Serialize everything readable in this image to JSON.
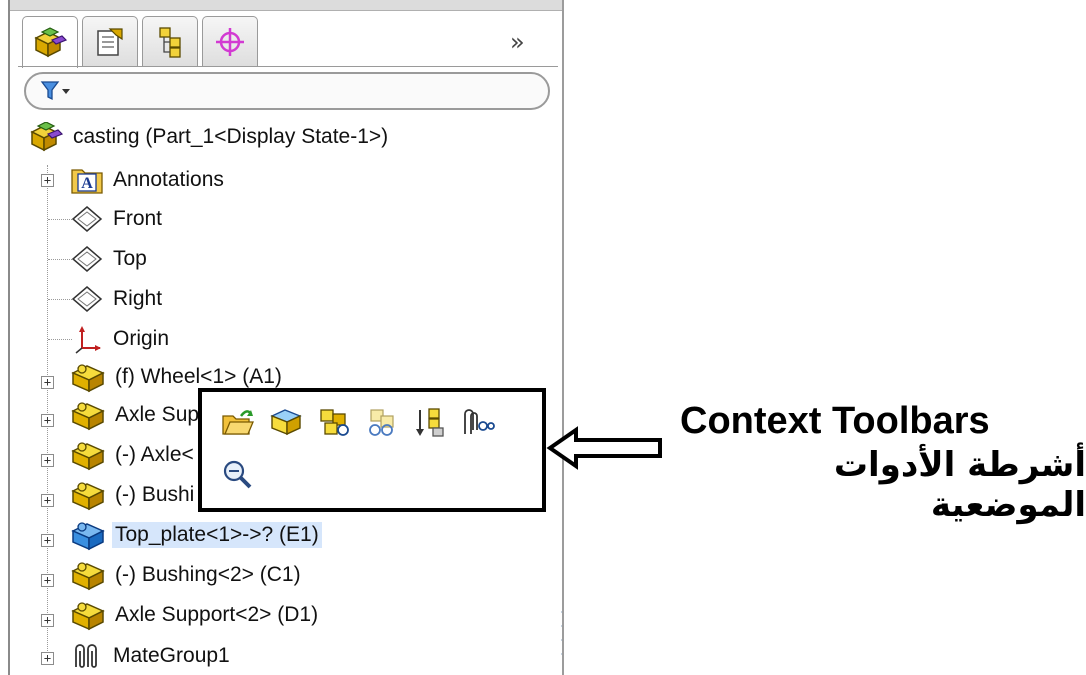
{
  "tabs": [
    {
      "name": "featuremanager-tab",
      "icon": "part-cubes-icon"
    },
    {
      "name": "propertymanager-tab",
      "icon": "property-sheet-icon"
    },
    {
      "name": "configurationmanager-tab",
      "icon": "configuration-tree-icon"
    },
    {
      "name": "dimxpert-tab",
      "icon": "target-crosshair-icon"
    }
  ],
  "tabs_more_label": "»",
  "filter": {
    "icon": "filter-funnel-icon"
  },
  "tree": {
    "root": "casting  (Part_1<Display State-1>)",
    "items": [
      {
        "label": "Annotations",
        "icon": "annotations-icon",
        "expandable": true
      },
      {
        "label": "Front",
        "icon": "plane-icon",
        "expandable": false
      },
      {
        "label": "Top",
        "icon": "plane-icon",
        "expandable": false
      },
      {
        "label": "Right",
        "icon": "plane-icon",
        "expandable": false
      },
      {
        "label": "Origin",
        "icon": "origin-icon",
        "expandable": false
      },
      {
        "label": "(f) Wheel<1> (A1)",
        "icon": "part-icon",
        "expandable": true
      },
      {
        "label": "Axle Sup",
        "icon": "part-icon",
        "expandable": true
      },
      {
        "label": "(-) Axle<",
        "icon": "part-icon",
        "expandable": true
      },
      {
        "label": "(-) Bushi",
        "icon": "part-icon",
        "expandable": true
      },
      {
        "label": "Top_plate<1>->? (E1)",
        "icon": "part-selected-icon",
        "expandable": true,
        "selected": true
      },
      {
        "label": "(-) Bushing<2> (C1)",
        "icon": "part-icon",
        "expandable": true
      },
      {
        "label": "Axle Support<2> (D1)",
        "icon": "part-icon",
        "expandable": true
      },
      {
        "label": "MateGroup1",
        "icon": "mates-paperclip-icon",
        "expandable": true
      }
    ]
  },
  "context_toolbar": {
    "buttons": [
      {
        "name": "open-part-button",
        "icon": "open-folder-arrow-icon"
      },
      {
        "name": "edit-part-button",
        "icon": "edit-part-icon"
      },
      {
        "name": "hide-components-button",
        "icon": "hide-components-icon"
      },
      {
        "name": "change-transparency-button",
        "icon": "transparency-icon"
      },
      {
        "name": "insert-components-button",
        "icon": "insert-component-icon"
      },
      {
        "name": "view-mates-button",
        "icon": "view-mates-icon"
      },
      {
        "name": "zoom-to-selection-button",
        "icon": "zoom-magnifier-icon"
      }
    ]
  },
  "callout": {
    "english": "Context Toolbars",
    "arabic": "أشرطة الأدوات الموضعية"
  },
  "colors": {
    "part_yellow": "#e8c21a",
    "part_selected_blue": "#3a8fe0",
    "selection_highlight": "#d6e6fb",
    "callout_border": "#000000"
  }
}
